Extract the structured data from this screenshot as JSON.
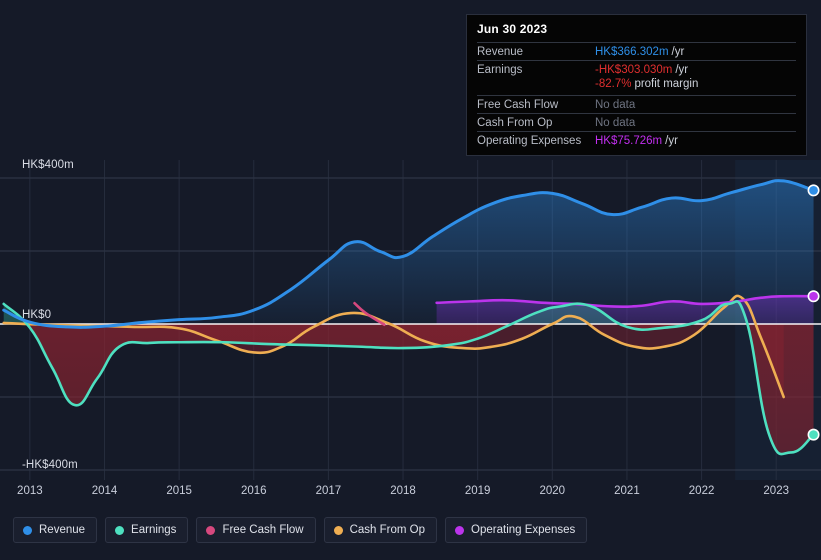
{
  "tooltip": {
    "title": "Jun 30 2023",
    "rows": [
      {
        "label": "Revenue",
        "value": "HK$366.302m",
        "suffix": "/yr",
        "color": "#2f8fe8"
      },
      {
        "label": "Earnings",
        "value": "-HK$303.030m",
        "suffix": "/yr",
        "color": "#e02f2f"
      },
      {
        "label": "",
        "value": "-82.7%",
        "suffix": "profit margin",
        "color": "#e02f2f",
        "sub": true
      },
      {
        "label": "Free Cash Flow",
        "value": "No data",
        "suffix": "",
        "color": "#6f7482"
      },
      {
        "label": "Cash From Op",
        "value": "No data",
        "suffix": "",
        "color": "#6f7482"
      },
      {
        "label": "Operating Expenses",
        "value": "HK$75.726m",
        "suffix": "/yr",
        "color": "#c22ff0"
      }
    ]
  },
  "axes": {
    "y_top_label": "HK$400m",
    "y_zero_label": "HK$0",
    "y_bottom_label": "-HK$400m",
    "x_ticks": [
      "2013",
      "2014",
      "2015",
      "2016",
      "2017",
      "2018",
      "2019",
      "2020",
      "2021",
      "2022",
      "2023"
    ]
  },
  "legend": [
    {
      "label": "Revenue",
      "color": "#2f8fe8"
    },
    {
      "label": "Earnings",
      "color": "#4ee0c0"
    },
    {
      "label": "Free Cash Flow",
      "color": "#d6487e"
    },
    {
      "label": "Cash From Op",
      "color": "#efae52"
    },
    {
      "label": "Operating Expenses",
      "color": "#bb34ec"
    }
  ],
  "chart_data": {
    "type": "area",
    "title": "",
    "xlabel": "",
    "ylabel": "HK$",
    "ylim": [
      -400,
      400
    ],
    "xlim": [
      2012.6,
      2023.6
    ],
    "grid": true,
    "legend_position": "bottom",
    "currency": "HK$",
    "units": "m",
    "gridlines_y": [
      400,
      200,
      0,
      -200,
      -400
    ],
    "forecast_region_start": 2022.45,
    "series": [
      {
        "name": "Revenue",
        "color": "#2f8fe8",
        "x": [
          2012.65,
          2013.0,
          2013.5,
          2014.0,
          2014.5,
          2015.0,
          2015.5,
          2016.0,
          2016.5,
          2017.0,
          2017.35,
          2017.7,
          2018.0,
          2018.4,
          2018.8,
          2019.2,
          2019.6,
          2020.0,
          2020.4,
          2020.8,
          2021.2,
          2021.6,
          2022.0,
          2022.4,
          2022.8,
          2023.1,
          2023.5
        ],
        "y": [
          38,
          5,
          -8,
          -6,
          4,
          12,
          18,
          38,
          95,
          175,
          225,
          198,
          185,
          240,
          290,
          330,
          352,
          358,
          330,
          300,
          320,
          345,
          338,
          360,
          382,
          392,
          366
        ]
      },
      {
        "name": "Earnings",
        "color": "#4ee0c0",
        "x": [
          2012.65,
          2013.0,
          2013.3,
          2013.6,
          2013.9,
          2014.2,
          2014.6,
          2015.0,
          2015.6,
          2016.2,
          2016.8,
          2017.4,
          2018.0,
          2018.6,
          2019.0,
          2019.4,
          2019.8,
          2020.1,
          2020.5,
          2021.0,
          2021.5,
          2022.0,
          2022.35,
          2022.6,
          2022.9,
          2023.2,
          2023.5
        ],
        "y": [
          55,
          -10,
          -120,
          -222,
          -150,
          -62,
          -52,
          -50,
          -50,
          -55,
          -58,
          -62,
          -66,
          -58,
          -40,
          -5,
          32,
          48,
          50,
          -8,
          -10,
          10,
          55,
          10,
          -300,
          -352,
          -303
        ]
      },
      {
        "name": "Free Cash Flow",
        "color": "#d6487e",
        "x": [
          2017.35,
          2017.5,
          2017.75
        ],
        "y": [
          57,
          30,
          -2
        ]
      },
      {
        "name": "Cash From Op",
        "color": "#efae52",
        "x": [
          2012.65,
          2013.2,
          2013.8,
          2014.4,
          2015.0,
          2015.5,
          2016.0,
          2016.4,
          2016.8,
          2017.3,
          2017.8,
          2018.3,
          2018.8,
          2019.2,
          2019.6,
          2020.0,
          2020.3,
          2020.7,
          2021.1,
          2021.5,
          2021.9,
          2022.3,
          2022.55,
          2022.8,
          2023.1
        ],
        "y": [
          3,
          -2,
          -5,
          -8,
          -12,
          -45,
          -78,
          -60,
          -8,
          30,
          2,
          -48,
          -66,
          -62,
          -40,
          0,
          20,
          -30,
          -62,
          -62,
          -30,
          45,
          70,
          -40,
          -200
        ]
      },
      {
        "name": "Operating Expenses",
        "color": "#bb34ec",
        "x": [
          2018.45,
          2018.9,
          2019.4,
          2019.9,
          2020.3,
          2020.8,
          2021.2,
          2021.6,
          2022.0,
          2022.4,
          2022.8,
          2023.1,
          2023.5
        ],
        "y": [
          58,
          62,
          65,
          58,
          55,
          48,
          50,
          62,
          55,
          60,
          72,
          76,
          76
        ]
      }
    ],
    "endpoints": [
      {
        "name": "Revenue",
        "x": 2023.5,
        "y": 366,
        "color": "#2f8fe8"
      },
      {
        "name": "Operating Expenses",
        "x": 2023.5,
        "y": 76,
        "color": "#bb34ec"
      },
      {
        "name": "Earnings",
        "x": 2023.5,
        "y": -303,
        "color": "#4ee0c0"
      }
    ]
  }
}
